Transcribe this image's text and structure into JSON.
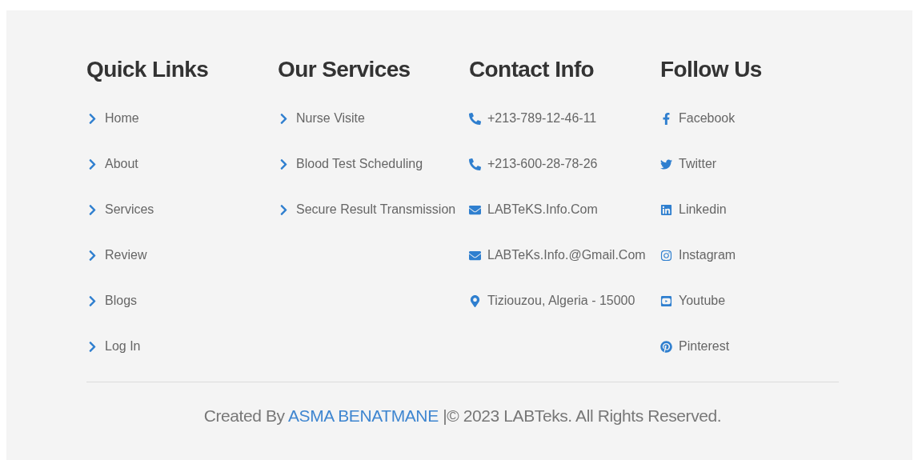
{
  "columns": [
    {
      "heading": "Quick Links",
      "items": [
        {
          "kind": "chevron",
          "label": "Home"
        },
        {
          "kind": "chevron",
          "label": "About"
        },
        {
          "kind": "chevron",
          "label": "Services"
        },
        {
          "kind": "chevron",
          "label": "Review"
        },
        {
          "kind": "chevron",
          "label": "Blogs"
        },
        {
          "kind": "chevron",
          "label": "Log In"
        }
      ]
    },
    {
      "heading": "Our Services",
      "items": [
        {
          "kind": "chevron",
          "label": "Nurse Visite"
        },
        {
          "kind": "chevron",
          "label": "Blood Test Scheduling"
        },
        {
          "kind": "chevron",
          "label": "Secure Result Transmission"
        }
      ]
    },
    {
      "heading": "Contact Info",
      "items": [
        {
          "kind": "phone",
          "label": "+213-789-12-46-11"
        },
        {
          "kind": "phone",
          "label": "+213-600-28-78-26"
        },
        {
          "kind": "email",
          "label": "LABTeKS.Info.Com"
        },
        {
          "kind": "email",
          "label": "LABTeKs.Info.@Gmail.Com"
        },
        {
          "kind": "location",
          "label": "Tiziouzou, Algeria - 15000"
        }
      ]
    },
    {
      "heading": "Follow Us",
      "items": [
        {
          "kind": "facebook",
          "label": "Facebook"
        },
        {
          "kind": "twitter",
          "label": "Twitter"
        },
        {
          "kind": "linkedin",
          "label": "Linkedin"
        },
        {
          "kind": "instagram",
          "label": "Instagram"
        },
        {
          "kind": "youtube",
          "label": "Youtube"
        },
        {
          "kind": "pinterest",
          "label": "Pinterest"
        }
      ]
    }
  ],
  "credit": {
    "prefix": "Created By",
    "author": "ASMA BENATMANE",
    "suffix": "|© 2023 LABTeks. All Rights Reserved."
  }
}
